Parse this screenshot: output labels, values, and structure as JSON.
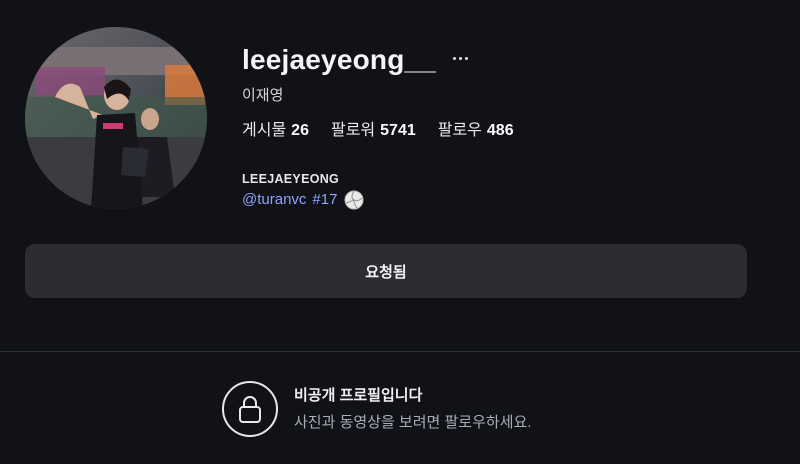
{
  "profile": {
    "username": "leejaeyeong__",
    "full_name": "이재영",
    "stats": [
      {
        "label": "게시물",
        "value": "26"
      },
      {
        "label": "팔로워",
        "value": "5741"
      },
      {
        "label": "팔로우",
        "value": "486"
      }
    ],
    "bio_name": "LEEJAEYEONG",
    "bio_mention": "@turanvc",
    "bio_tag": "#17",
    "bio_icon": "volleyball-icon"
  },
  "actions": {
    "request_label": "요청됨",
    "more_icon": "more-horizontal-icon"
  },
  "private_notice": {
    "icon": "lock-icon",
    "title": "비공개 프로필입니다",
    "subtitle": "사진과 동영상을 보려면 팔로우하세요."
  },
  "colors": {
    "background": "#101217",
    "link": "#8ea3ff",
    "button_bg": "#2b2d32"
  }
}
